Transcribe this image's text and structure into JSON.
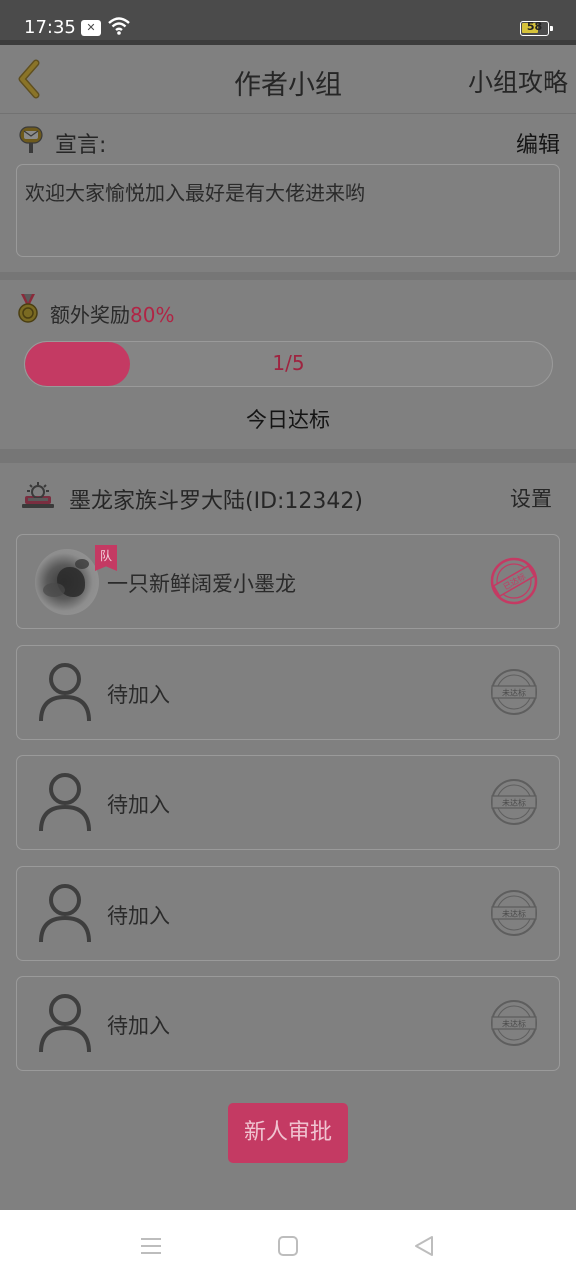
{
  "status_bar": {
    "time": "17:35",
    "notification_icon": "x-box-icon",
    "wifi_icon": "wifi-icon",
    "battery_level": "58",
    "battery_color": "#d6c23a"
  },
  "header": {
    "back_icon": "chevron-left-icon",
    "title": "作者小组",
    "strategy_label": "小组攻略"
  },
  "declaration": {
    "icon": "mailbox-icon",
    "label": "宣言:",
    "edit_label": "编辑",
    "text": "欢迎大家愉悦加入最好是有大佬进来哟"
  },
  "bonus": {
    "icon": "medal-icon",
    "label": "额外奖励",
    "percent": "80%",
    "progress_text": "1/5",
    "progress_fraction": 0.2,
    "today_label": "今日达标"
  },
  "family": {
    "icon": "family-crest-icon",
    "name": "墨龙家族斗罗大陆(ID:12342)",
    "settings_label": "设置"
  },
  "members": [
    {
      "name": "一只新鲜阔爱小墨龙",
      "badge": "队",
      "stamp": "已达标",
      "joined": true
    },
    {
      "name": "待加入",
      "stamp": "未达标",
      "joined": false
    },
    {
      "name": "待加入",
      "stamp": "未达标",
      "joined": false
    },
    {
      "name": "待加入",
      "stamp": "未达标",
      "joined": false
    },
    {
      "name": "待加入",
      "stamp": "未达标",
      "joined": false
    }
  ],
  "approve_button": "新人审批",
  "colors": {
    "accent": "#c43a63",
    "overlay_background": "#808080",
    "percent_text": "#b02545"
  },
  "system_nav": [
    "menu-icon",
    "home-square-icon",
    "back-triangle-icon"
  ]
}
